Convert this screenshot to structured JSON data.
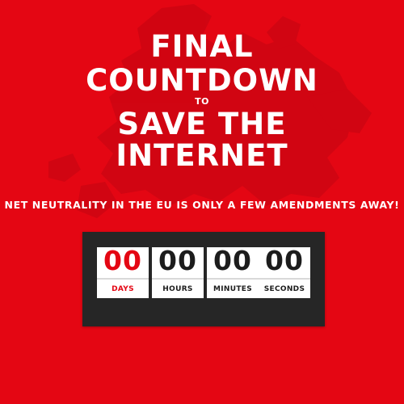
{
  "headline": {
    "line1": "FINAL",
    "line2": "COUNTDOWN",
    "line3": "TO",
    "line4": "SAVE THE",
    "line5": "INTERNET"
  },
  "subtitle": "NET NEUTRALITY IN THE EU IS ONLY A FEW AMENDMENTS AWAY!",
  "countdown": {
    "days": {
      "value": "00",
      "label": "DAYS"
    },
    "hours": {
      "value": "00",
      "label": "HOURS"
    },
    "minutes": {
      "value": "00",
      "label": "MINUTES"
    },
    "seconds": {
      "value": "00",
      "label": "SECONDS"
    }
  },
  "colors": {
    "background": "#e40613",
    "counter_panel": "#262626",
    "accent": "#e40613"
  }
}
